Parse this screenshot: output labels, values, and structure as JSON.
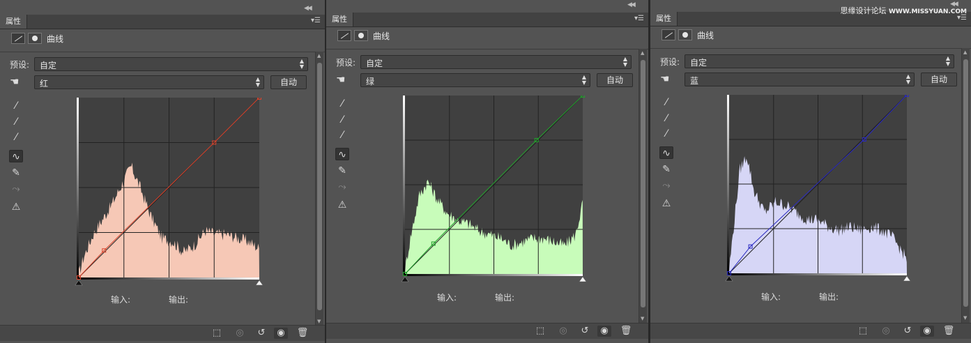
{
  "watermark": {
    "site_name": "思缘设计论坛",
    "url": "WWW.MISSYUAN.COM"
  },
  "panels": [
    {
      "tab_label": "属性",
      "adjustment_title": "曲线",
      "preset_label": "预设:",
      "preset_value": "自定",
      "channel_value": "红",
      "auto_button": "自动",
      "input_label": "输入:",
      "output_label": "输出:",
      "curve_color": "#d9432c",
      "hist_color": "#f6c8b6"
    },
    {
      "tab_label": "属性",
      "adjustment_title": "曲线",
      "preset_label": "预设:",
      "preset_value": "自定",
      "channel_value": "绿",
      "auto_button": "自动",
      "input_label": "输入:",
      "output_label": "输出:",
      "curve_color": "#22a02c",
      "hist_color": "#c8fcba"
    },
    {
      "tab_label": "属性",
      "adjustment_title": "曲线",
      "preset_label": "预设:",
      "preset_value": "自定",
      "channel_value": "蓝",
      "auto_button": "自动",
      "input_label": "输入:",
      "output_label": "输出:",
      "curve_color": "#2a2ac0",
      "hist_color": "#d6d6f6"
    }
  ],
  "icons": {
    "curves": "curves-icon",
    "mask": "mask-icon",
    "hand": "targeted-adjustment-hand-icon",
    "eyedropper_black": "black-point-eyedropper-icon",
    "eyedropper_gray": "gray-point-eyedropper-icon",
    "eyedropper_white": "white-point-eyedropper-icon",
    "curve_tool": "edit-curve-points-icon",
    "pencil": "pencil-draw-icon",
    "smooth": "smooth-curve-icon",
    "clipping": "clipping-warning-icon",
    "clip_layer": "clip-to-layer-icon",
    "view_prev": "view-previous-state-icon",
    "reset": "reset-icon",
    "visibility": "visibility-eye-icon",
    "delete": "trash-icon"
  }
}
